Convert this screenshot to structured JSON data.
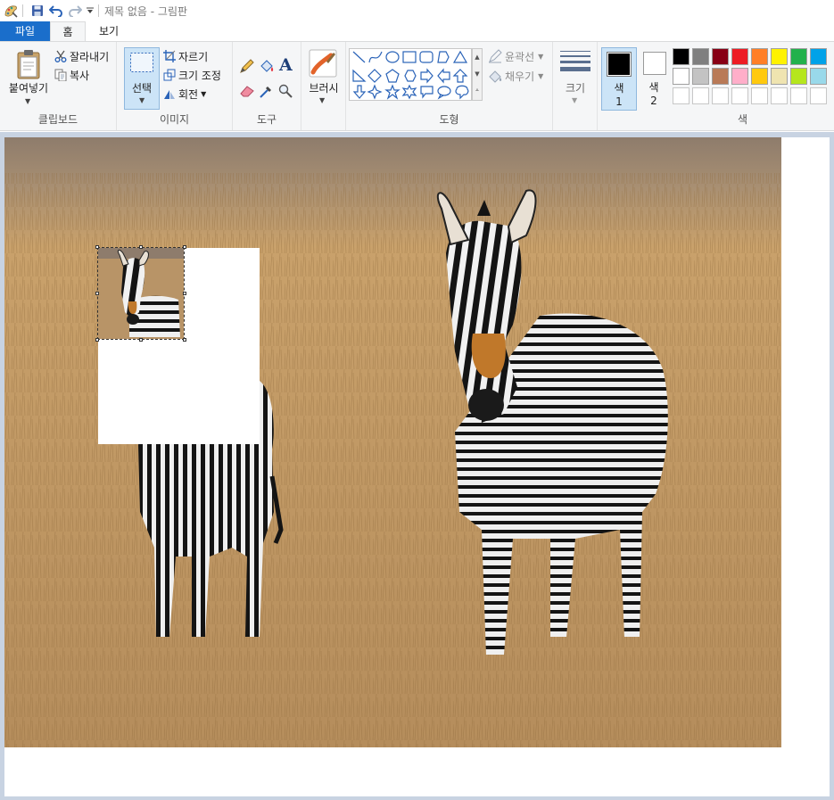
{
  "window": {
    "title": "제목 없음 - 그림판"
  },
  "tabs": {
    "file": "파일",
    "home": "홈",
    "view": "보기"
  },
  "clipboard": {
    "paste": "붙여넣기",
    "cut": "잘라내기",
    "copy": "복사",
    "label": "클립보드"
  },
  "image": {
    "select": "선택",
    "crop": "자르기",
    "resize": "크기 조정",
    "rotate": "회전",
    "label": "이미지"
  },
  "tools": {
    "label": "도구"
  },
  "brushes": {
    "label": "브러시"
  },
  "shapes": {
    "outline": "윤곽선",
    "fill": "채우기",
    "label": "도형"
  },
  "size": {
    "label": "크기"
  },
  "colors": {
    "color1_line1": "색",
    "color1_line2": "1",
    "color2_line1": "색",
    "color2_line2": "2",
    "label": "색",
    "color1_value": "#000000",
    "color2_value": "#ffffff",
    "palette_row1": [
      "#000000",
      "#7f7f7f",
      "#880015",
      "#ed1c24",
      "#ff7f27",
      "#fff200",
      "#22b14c",
      "#00a2e8"
    ],
    "palette_row2": [
      "#ffffff",
      "#c3c3c3",
      "#b97a57",
      "#ffaec9",
      "#ffc90e",
      "#efe4b0",
      "#b5e61d",
      "#99d9ea"
    ]
  }
}
